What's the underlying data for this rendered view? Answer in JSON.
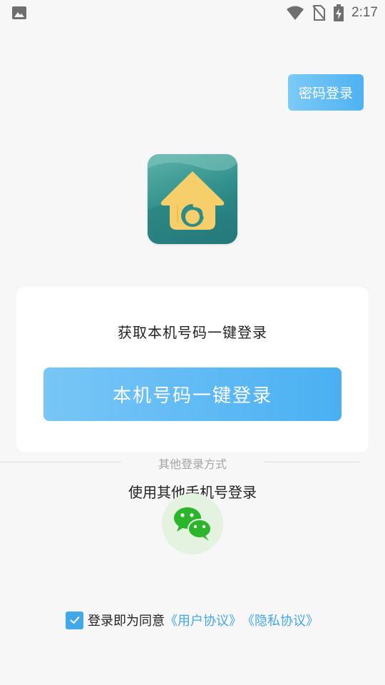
{
  "status_bar": {
    "time": "2:17"
  },
  "header": {
    "password_login_label": "密码登录"
  },
  "card": {
    "title": "获取本机号码一键登录",
    "button_label": "本机号码一键登录"
  },
  "other_methods": {
    "label": "其他登录方式",
    "phone_login_label": "使用其他手机号登录"
  },
  "agreement": {
    "checked": true,
    "text": "登录即为同意",
    "user_agreement": "《用户协议》",
    "privacy_agreement": "《隐私协议》"
  },
  "colors": {
    "accent": "#4fb2f2",
    "link": "#45a7e8",
    "wechat_green": "#2ab52a"
  }
}
